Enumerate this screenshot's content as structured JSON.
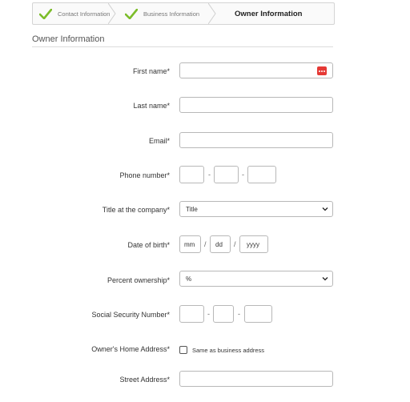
{
  "wizard": {
    "steps": [
      {
        "label": "Contact Information",
        "state": "complete"
      },
      {
        "label": "Business Information",
        "state": "complete"
      },
      {
        "label": "Owner Information",
        "state": "current"
      }
    ],
    "check_color": "#7cbd2a"
  },
  "section": {
    "title": "Owner Information"
  },
  "form": {
    "first_name": {
      "label": "First name*",
      "value": ""
    },
    "last_name": {
      "label": "Last name*",
      "value": ""
    },
    "email": {
      "label": "Email*",
      "value": ""
    },
    "phone": {
      "label": "Phone number*",
      "separator": "-"
    },
    "title": {
      "label": "Title at the company*",
      "selected": "Title"
    },
    "dob": {
      "label": "Date of birth*",
      "separator": "/",
      "month_placeholder": "mm",
      "day_placeholder": "dd",
      "year_placeholder": "yyyy"
    },
    "ownership": {
      "label": "Percent ownership*",
      "selected": "%"
    },
    "ssn": {
      "label": "Social Security Number*",
      "separator": "-"
    },
    "home_address": {
      "label": "Owner's Home Address*",
      "checkbox_label": "Same as business address",
      "checked": false
    },
    "street_address": {
      "label": "Street Address*",
      "value": ""
    }
  },
  "icons": {
    "autofill": "password-manager-icon",
    "dropdown": "chevron-down-icon",
    "step_done": "checkmark-icon"
  }
}
